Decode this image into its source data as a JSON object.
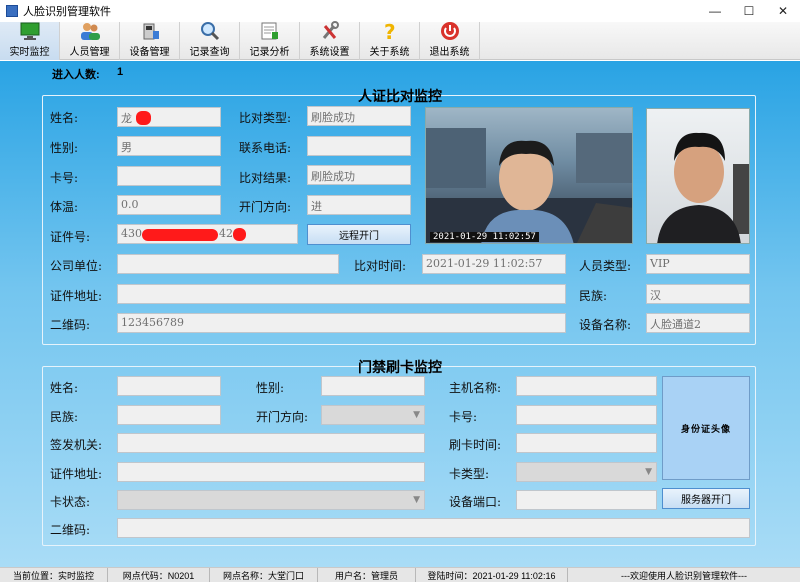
{
  "window": {
    "title": "人脸识别管理软件"
  },
  "toolbar": [
    {
      "label": "实时监控",
      "icon": "monitor-icon"
    },
    {
      "label": "人员管理",
      "icon": "users-icon"
    },
    {
      "label": "设备管理",
      "icon": "device-icon"
    },
    {
      "label": "记录查询",
      "icon": "magnifier-icon"
    },
    {
      "label": "记录分析",
      "icon": "analysis-icon"
    },
    {
      "label": "系统设置",
      "icon": "wrench-icon"
    },
    {
      "label": "关于系统",
      "icon": "question-icon"
    },
    {
      "label": "退出系统",
      "icon": "power-icon"
    }
  ],
  "entry": {
    "label": "进入人数:",
    "value": "1"
  },
  "face_panel": {
    "title": "人证比对监控",
    "name_label": "姓名:",
    "name_value": "龙",
    "gender_label": "性别:",
    "gender_value": "男",
    "card_label": "卡号:",
    "card_value": "",
    "temp_label": "体温:",
    "temp_value": "0.0",
    "id_label": "证件号:",
    "id_value_prefix": "430",
    "id_value_suffix": "421",
    "match_type_label": "比对类型:",
    "match_type_value": "刷脸成功",
    "phone_label": "联系电话:",
    "phone_value": "",
    "match_result_label": "比对结果:",
    "match_result_value": "刷脸成功",
    "door_dir_label": "开门方向:",
    "door_dir_value": "进",
    "remote_open_button": "远程开门",
    "company_label": "公司单位:",
    "company_value": "",
    "match_time_label": "比对时间:",
    "match_time_value": "2021-01-29 11:02:57",
    "person_type_label": "人员类型:",
    "person_type_value": "VIP",
    "address_label": "证件地址:",
    "address_value": "",
    "nation_label": "民族:",
    "nation_value": "汉",
    "qrcode_label": "二维码:",
    "qrcode_value": "123456789",
    "device_label": "设备名称:",
    "device_value": "人脸通道2",
    "camera_timestamp": "2021-01-29 11:02:57"
  },
  "card_panel": {
    "title": "门禁刷卡监控",
    "name_label": "姓名:",
    "gender_label": "性别:",
    "host_label": "主机名称:",
    "nation_label": "民族:",
    "door_dir_label": "开门方向:",
    "card_label": "卡号:",
    "issuer_label": "签发机关:",
    "swipe_time_label": "刷卡时间:",
    "address_label": "证件地址:",
    "card_type_label": "卡类型:",
    "card_status_label": "卡状态:",
    "port_label": "设备端口:",
    "qrcode_label": "二维码:",
    "id_photo_text": "身份证头像",
    "server_open_button": "服务器开门"
  },
  "status": {
    "location": "当前位置：实时监控",
    "site_code": "网点代码：N0201",
    "site_name": "网点名称：大堂门口",
    "user": "用户名：管理员",
    "login_time": "登陆时间：2021-01-29 11:02:16",
    "welcome": "---欢迎使用人脸识别管理软件---"
  },
  "colors": {
    "accent": "#29a3e4",
    "redaction": "#ff1a1a"
  }
}
